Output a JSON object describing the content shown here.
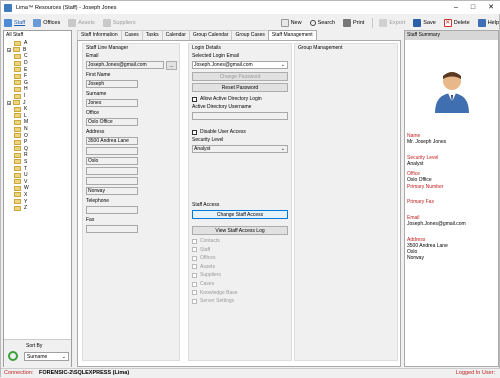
{
  "window": {
    "title": "Lima™ Resources (Staff) - Joseph Jones"
  },
  "toolbar": {
    "staff": "Staff",
    "offices": "Offices",
    "assets": "Assets",
    "suppliers": "Suppliers",
    "new": "New",
    "search": "Search",
    "print": "Print",
    "export": "Export",
    "save": "Save",
    "delete": "Delete",
    "help": "Help"
  },
  "sidebar": {
    "title": "All Staff",
    "letters": [
      "A",
      "B",
      "C",
      "D",
      "E",
      "F",
      "G",
      "H",
      "I",
      "J",
      "K",
      "L",
      "M",
      "N",
      "O",
      "P",
      "Q",
      "R",
      "S",
      "T",
      "U",
      "V",
      "W",
      "X",
      "Y",
      "Z"
    ],
    "sort_label": "Sort By",
    "sort_value": "Surname"
  },
  "tabs": [
    "Staff Information",
    "Cases",
    "Tasks",
    "Calendar",
    "Group Calendar",
    "Group Cases",
    "Staff Management"
  ],
  "line_manager": {
    "title": "Staff Line Manager",
    "email_label": "Email",
    "email_value": "Joseph.Jones@gmail.com",
    "email_btn": "...",
    "first_name_label": "First Name",
    "first_name_value": "Joseph",
    "surname_label": "Surname",
    "surname_value": "Jones",
    "office_label": "Office",
    "office_value": "Oslo Office",
    "address_label": "Address",
    "address_lines": [
      "3500 Andrea Lane",
      "",
      "Oslo",
      "",
      "",
      "Norway"
    ],
    "telephone_label": "Telephone",
    "telephone_value": "",
    "fax_label": "Fax",
    "fax_value": ""
  },
  "login": {
    "title": "Login Details",
    "selected_email_label": "Selected Login Email",
    "selected_email_value": "Joseph.Jones@gmail.com",
    "change_password": "Change Password",
    "reset_password": "Reset Password",
    "allow_ad": "Allow Active Directory Login",
    "ad_username_label": "Active Directory Username",
    "ad_username_value": "",
    "disable_access": "Disable User Access",
    "security_level_label": "Security Level",
    "security_level_value": "Analyst"
  },
  "staff_access": {
    "title": "Staff Access",
    "change_btn": "Change Staff Access",
    "view_log_btn": "View Staff Access Log",
    "items": [
      "Contacts",
      "Staff",
      "Offices",
      "Assets",
      "Suppliers",
      "Cases",
      "Knowledge Base",
      "Server Settings"
    ]
  },
  "group_management": {
    "title": "Group Management"
  },
  "summary": {
    "title": "Staff Summary",
    "name_label": "Name",
    "name_value": "Mr. Joseph Jones",
    "security_label": "Security Level",
    "security_value": "Analyst",
    "office_label": "Office",
    "office_value": "Oslo Office",
    "primary_number_label": "Primary Number",
    "primary_fax_label": "Primary Fax",
    "email_label": "Email",
    "email_value": "Joseph.Jones@gmail.com",
    "address_label": "Address",
    "address_lines": [
      "3500 Andrea Lane",
      "Oslo",
      "Norway"
    ]
  },
  "status": {
    "connection_label": "Connection:",
    "connection_value": "FORENSIC-2\\SQLEXPRESS (Lima)",
    "logged_in_label": "Logged In User:"
  },
  "colors": {
    "accent": "#0078d7",
    "label_red": "#c02020",
    "brand": "#3d7cc0"
  }
}
